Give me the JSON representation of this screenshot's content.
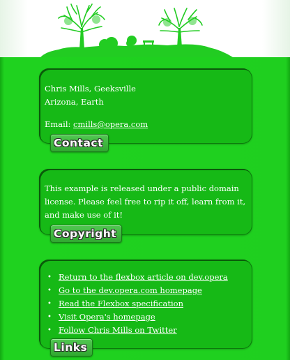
{
  "contact": {
    "line1": "Chris Mills, Geeksville",
    "line2": "Arizona, Earth",
    "email_label": "Email:",
    "email": "cmills@opera.com",
    "heading": "Contact"
  },
  "copyright": {
    "text": "This example is released under a public domain license. Please feel free to rip it off, learn from it, and make use of it!",
    "heading": "Copyright"
  },
  "links": {
    "heading": "Links",
    "items": [
      {
        "label": "Return to the flexbox article on dev.opera"
      },
      {
        "label": "Go to the dev.opera.com homepage"
      },
      {
        "label": "Read the Flexbox specification"
      },
      {
        "label": "Visit Opera's homepage"
      },
      {
        "label": "Follow Chris Mills on Twitter"
      }
    ]
  },
  "colors": {
    "background": "#1ec81e",
    "card": "#16b916",
    "header": "#ffffff",
    "illustration": "#22cc22"
  },
  "icons": {
    "bullet": "•"
  }
}
